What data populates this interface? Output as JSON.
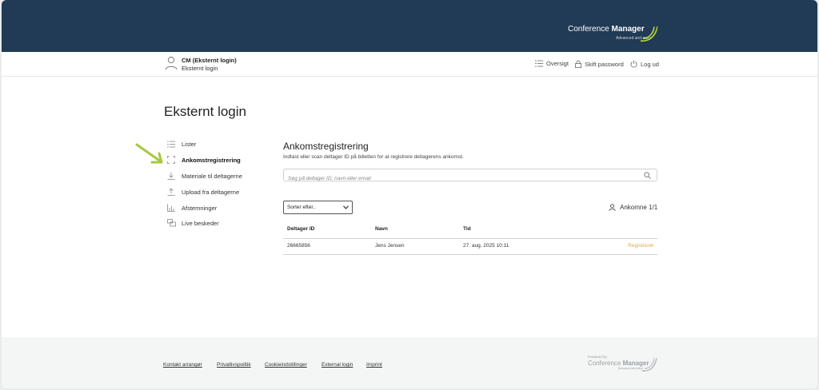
{
  "brand": {
    "name_light": "Conference ",
    "name_bold": "Manager",
    "tagline": "Advanced and easy",
    "accent": "#b3cf2f"
  },
  "user": {
    "name": "CM (Eksternt login)",
    "subtitle": "Eksternt login"
  },
  "topnav": [
    {
      "label": "Oversigt",
      "icon": "list-icon"
    },
    {
      "label": "Skift password",
      "icon": "lock-icon"
    },
    {
      "label": "Log ud",
      "icon": "power-icon"
    }
  ],
  "page": {
    "title": "Eksternt login"
  },
  "sidebar": {
    "items": [
      {
        "label": "Lister",
        "icon": "list-icon",
        "active": false
      },
      {
        "label": "Ankomstregistrering",
        "icon": "scan-icon",
        "active": true
      },
      {
        "label": "Materiale til deltagerne",
        "icon": "download-icon",
        "active": false
      },
      {
        "label": "Upload fra deltagerne",
        "icon": "upload-icon",
        "active": false
      },
      {
        "label": "Afstemninger",
        "icon": "bar-chart-icon",
        "active": false
      },
      {
        "label": "Live beskeder",
        "icon": "chat-icon",
        "active": false
      }
    ]
  },
  "main": {
    "title": "Ankomstregistrering",
    "subtitle": "Indtast eller scan deltager ID på billetten for at registrere deltagerens ankomst.",
    "search_placeholder": "Søg på deltager ID, navn eller email",
    "sort_label": "Sorter efter..",
    "arrivals_label": "Ankomne 1/1"
  },
  "table": {
    "headers": [
      "Deltager ID",
      "Navn",
      "Tid"
    ],
    "rows": [
      {
        "id": "26665856",
        "name": "Jens Jensen",
        "time": "27. aug. 2025 10:11",
        "status": "Registreret"
      }
    ],
    "status_color": "#e0a94a"
  },
  "footer": {
    "links": [
      "Kontakt arrangør",
      "Privatlivspolitik",
      "Cookieindstillinger",
      "External login",
      "Imprint"
    ],
    "powered_by": "Powered by",
    "powered_name_light": "Conference ",
    "powered_name_bold": "Manager",
    "powered_tagline": "Advanced and easy"
  },
  "colors": {
    "header_bg": "#213a55",
    "arrow": "#a8c83c"
  }
}
